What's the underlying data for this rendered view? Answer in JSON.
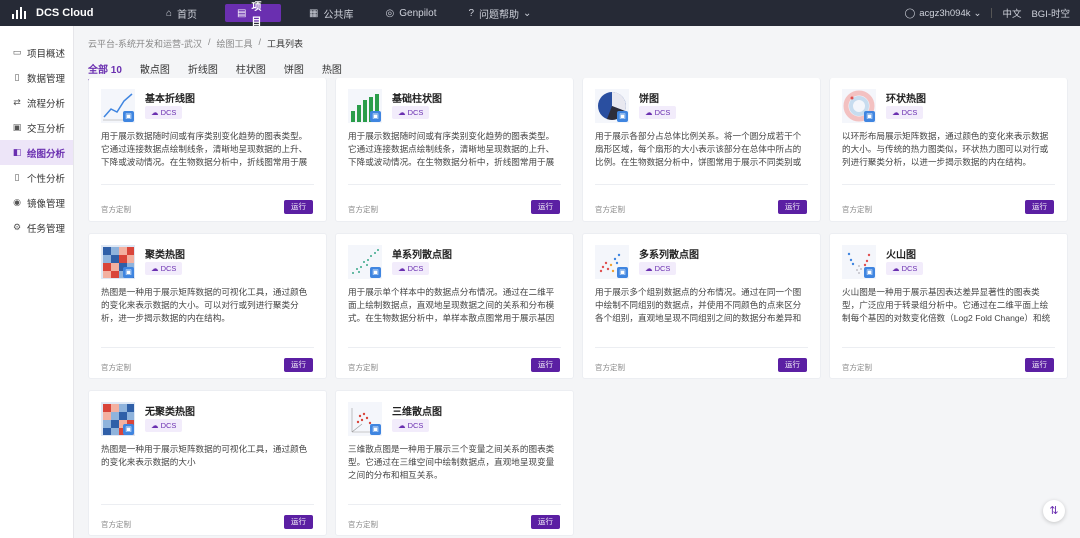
{
  "app": {
    "name": "DCS Cloud"
  },
  "nav": [
    {
      "label": "首页",
      "icon": "home-icon",
      "glyph": "⌂"
    },
    {
      "label": "项目",
      "icon": "project-icon",
      "glyph": "▤"
    },
    {
      "label": "公共库",
      "icon": "library-icon",
      "glyph": "▦"
    },
    {
      "label": "Genpilot",
      "icon": "genpilot-icon",
      "glyph": "◎"
    },
    {
      "label": "问题帮助",
      "icon": "help-icon",
      "glyph": "?"
    }
  ],
  "nav_help_chevron": "⌄",
  "user": {
    "name": "acgz3h094k",
    "chevron": "⌄",
    "language": "中文",
    "org": "BGI-时空"
  },
  "sidebar": [
    {
      "label": "项目概述",
      "glyph": "▭"
    },
    {
      "label": "数据管理",
      "glyph": "▯"
    },
    {
      "label": "流程分析",
      "glyph": "⇄"
    },
    {
      "label": "交互分析",
      "glyph": "▣"
    },
    {
      "label": "绘图分析",
      "glyph": "◧"
    },
    {
      "label": "个性分析",
      "glyph": "▯"
    },
    {
      "label": "镜像管理",
      "glyph": "◉"
    },
    {
      "label": "任务管理",
      "glyph": "⚙"
    }
  ],
  "breadcrumb": [
    "云平台-系统开发和运营-武汉",
    "/",
    "绘图工具",
    "/",
    "工具列表"
  ],
  "tabs": [
    "全部 10",
    "散点图",
    "折线图",
    "柱状图",
    "饼图",
    "热图"
  ],
  "cards": [
    {
      "title": "基本折线图",
      "tag": "DCS",
      "desc": "用于展示数据随时间或有序类别变化趋势的图表类型。它通过连接数据点绘制线条，清晰地呈现数据的上升、下降或波动情况。在生物数据分析中，折线图常用于展示基因表达...",
      "official": "官方定制",
      "run": "运行"
    },
    {
      "title": "基础柱状图",
      "tag": "DCS",
      "desc": "用于展示数据随时间或有序类别变化趋势的图表类型。它通过连接数据点绘制线条，清晰地呈现数据的上升、下降或波动情况。在生物数据分析中，折线图常用于展示基因表达...",
      "official": "官方定制",
      "run": "运行"
    },
    {
      "title": "饼图",
      "tag": "DCS",
      "desc": "用于展示各部分占总体比例关系。将一个圆分成若干个扇形区域，每个扇形的大小表示该部分在总体中所占的比例。在生物数据分析中，饼图常用于展示不同类别或组别在整体...",
      "official": "官方定制",
      "run": "运行"
    },
    {
      "title": "环状热图",
      "tag": "DCS",
      "desc": "以环形布局展示矩阵数据，通过颜色的变化来表示数据的大小。与传统的热力图类似，环状热力图可以对行或列进行聚类分析，以进一步揭示数据的内在结构。",
      "official": "官方定制",
      "run": "运行"
    },
    {
      "title": "聚类热图",
      "tag": "DCS",
      "desc": "热图是一种用于展示矩阵数据的可视化工具，通过颜色的变化来表示数据的大小。可以对行或列进行聚类分析，进一步揭示数据的内在结构。",
      "official": "官方定制",
      "run": "运行"
    },
    {
      "title": "单系列散点图",
      "tag": "DCS",
      "desc": "用于展示单个样本中的数据点分布情况。通过在二维平面上绘制数据点，直观地呈现数据之间的关系和分布模式。在生物数据分析中，单样本散点图常用于展示基因表达水平、...",
      "official": "官方定制",
      "run": "运行"
    },
    {
      "title": "多系列散点图",
      "tag": "DCS",
      "desc": "用于展示多个组别数据点的分布情况。通过在同一个图中绘制不同组别的数据点，并使用不同颜色的点来区分各个组别，直观地呈现不同组别之间的数据分布差异和关系。",
      "official": "官方定制",
      "run": "运行"
    },
    {
      "title": "火山图",
      "tag": "DCS",
      "desc": "火山图是一种用于展示基因表达差异显著性的图表类型，广泛应用于转录组分析中。它通过在二维平面上绘制每个基因的对数变化倍数（Log2 Fold Change）和统计显著性（-...",
      "official": "官方定制",
      "run": "运行"
    },
    {
      "title": "无聚类热图",
      "tag": "DCS",
      "desc": "热图是一种用于展示矩阵数据的可视化工具，通过颜色的变化来表示数据的大小",
      "official": "官方定制",
      "run": "运行"
    },
    {
      "title": "三维散点图",
      "tag": "DCS",
      "desc": "三维散点图是一种用于展示三个变量之间关系的图表类型。它通过在三维空间中绘制数据点，直观地呈现变量之间的分布和相互关系。",
      "official": "官方定制",
      "run": "运行"
    }
  ],
  "colors": {
    "accent": "#6a2fb0",
    "button": "#5b1fa3",
    "topbar": "#262a36"
  }
}
